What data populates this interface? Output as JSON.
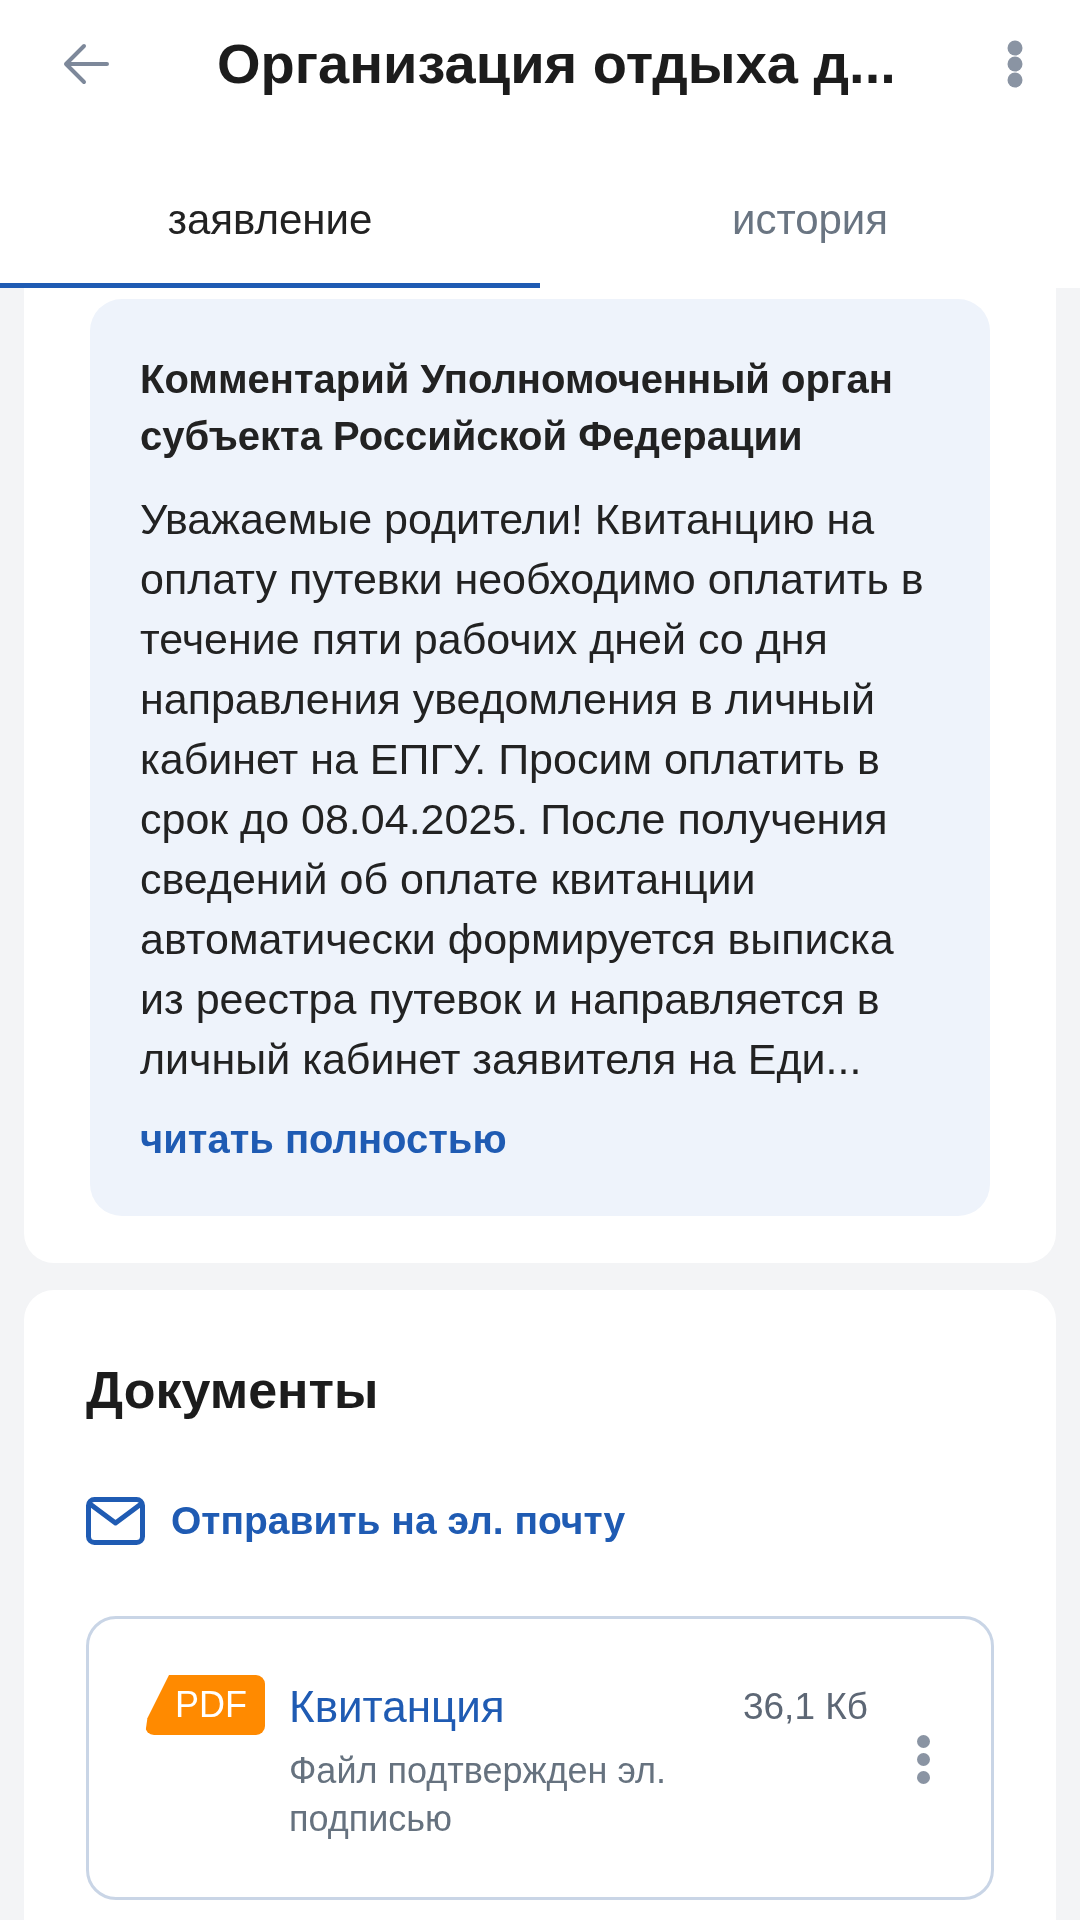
{
  "header": {
    "title": "Организация отдыха д..."
  },
  "tabs": [
    {
      "label": "заявление",
      "selected": true
    },
    {
      "label": "история",
      "selected": false
    }
  ],
  "comment": {
    "title": "Комментарий Уполномоченный орган субъекта Российской Федерации",
    "text": "Уважаемые родители! Квитанцию на оплату путевки необходимо оплатить в течение пяти рабочих дней со дня направления уведомления в личный кабинет на ЕПГУ. Просим оплатить в срок до 08.04.2025. После получения сведений об оплате квитанции автоматически формируется выписка из реестра путевок и направляется в личный кабинет заявителя на Еди...",
    "link": "читать полностью"
  },
  "documents": {
    "title": "Документы",
    "send_email": "Отправить на эл. почту",
    "files": [
      {
        "badge": "PDF",
        "name": "Квитанция",
        "size": "36,1 Кб",
        "note": "Файл подтвержден эл. подписью"
      }
    ]
  }
}
